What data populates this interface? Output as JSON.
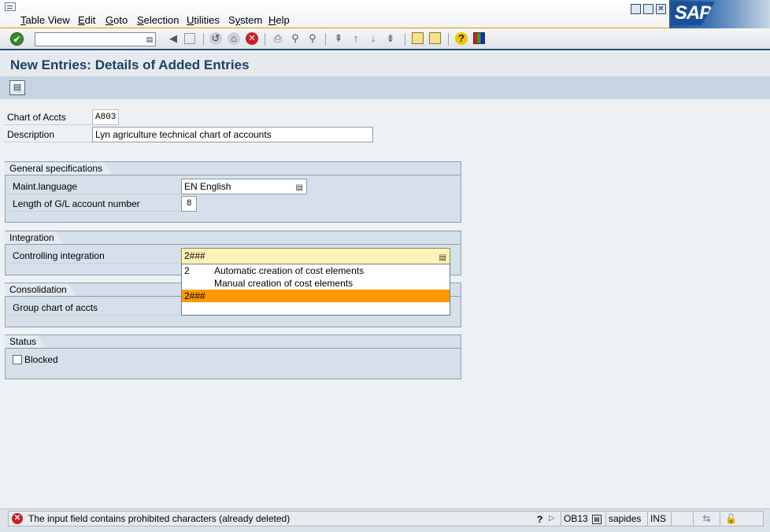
{
  "menu": {
    "items": [
      {
        "label": "Table View",
        "u": "T"
      },
      {
        "label": "Edit",
        "u": "E"
      },
      {
        "label": "Goto",
        "u": "G"
      },
      {
        "label": "Selection",
        "u": "S"
      },
      {
        "label": "Utilities",
        "u": "U"
      },
      {
        "label": "System",
        "u": "y"
      },
      {
        "label": "Help",
        "u": "H"
      }
    ],
    "logo_text": "SAP"
  },
  "toolbar": {
    "command_field_value": "",
    "icons": [
      "enter-icon",
      "command-dropdown-icon",
      "back-nav-icon",
      "save-icon",
      "back-icon",
      "exit-icon",
      "cancel-icon",
      "print-icon",
      "find-icon",
      "find-next-icon",
      "first-page-icon",
      "previous-page-icon",
      "next-page-icon",
      "last-page-icon",
      "create-session-icon",
      "shortcut-icon",
      "help-icon",
      "layout-menu-icon"
    ]
  },
  "title": "New Entries: Details of Added Entries",
  "app_toolbar": {
    "icons": [
      "select-detail-icon"
    ]
  },
  "header_fields": {
    "chart_of_accts_label": "Chart of Accts",
    "chart_of_accts_value": "A803",
    "description_label": "Description",
    "description_value": "Lyn agriculture technical chart of accounts"
  },
  "general": {
    "title": "General specifications",
    "maint_language_label": "Maint.language",
    "maint_language_value": "EN English",
    "gl_length_label": "Length of G/L account number",
    "gl_length_value": "8"
  },
  "integration": {
    "title": "Integration",
    "controlling_label": "Controlling integration",
    "controlling_value": "2###",
    "options": [
      {
        "key": "2",
        "text": "Automatic creation of cost elements"
      },
      {
        "key": "",
        "text": "Manual creation of cost elements"
      },
      {
        "key": "2###",
        "text": "",
        "selected": true
      },
      {
        "key": "",
        "text": ""
      }
    ]
  },
  "consolidation": {
    "title": "Consolidation",
    "group_chart_label": "Group chart of accts"
  },
  "status": {
    "title": "Status",
    "blocked_label": "Blocked",
    "blocked_checked": false
  },
  "status_bar": {
    "message": "The input field contains prohibited characters (already deleted)",
    "transaction": "OB13",
    "server": "sapides",
    "mode": "INS"
  },
  "colors": {
    "selected_option": "#ff9900",
    "title_text": "#1f3f66",
    "error": "#c8202a"
  }
}
